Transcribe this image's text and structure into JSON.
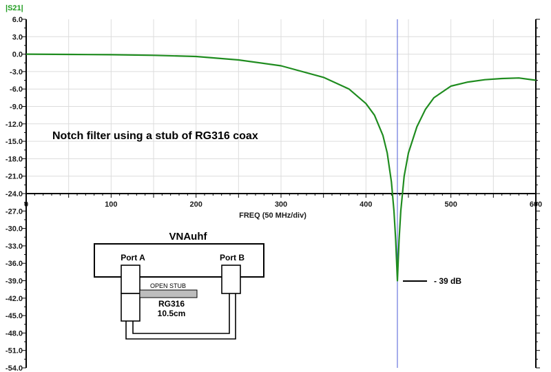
{
  "chart_data": {
    "type": "line",
    "ylabel": "|S21|",
    "xlabel": "FREQ (50 MHz/div)",
    "xlim": [
      0,
      600
    ],
    "ylim": [
      -54,
      6
    ],
    "xticks": [
      0,
      100,
      200,
      300,
      400,
      500,
      600
    ],
    "yticks": [
      6,
      3,
      0,
      -3,
      -6,
      -9,
      -12,
      -15,
      -18,
      -21,
      -24,
      -27,
      -30,
      -33,
      -36,
      -39,
      -42,
      -45,
      -48,
      -51,
      -54
    ],
    "ytick_labels": [
      "6.0",
      "3.0",
      "0.0",
      "-3.0",
      "-6.0",
      "-9.0",
      "-12.0",
      "-15.0",
      "-18.0",
      "-21.0",
      "-24.0",
      "-27.0",
      "-30.0",
      "-33.0",
      "-36.0",
      "-39.0",
      "-42.0",
      "-45.0",
      "-48.0",
      "-51.0",
      "-54.0"
    ],
    "xtick_labels": [
      "0",
      "100",
      "200",
      "300",
      "400",
      "500",
      "600"
    ],
    "grid": true,
    "marker_x": 437,
    "series": [
      {
        "color": "#1f8c1f",
        "x": [
          0,
          50,
          100,
          150,
          200,
          250,
          300,
          350,
          380,
          400,
          410,
          420,
          425,
          430,
          433,
          435,
          437,
          439,
          441,
          445,
          450,
          460,
          470,
          480,
          500,
          520,
          540,
          560,
          580,
          600
        ],
        "y": [
          0,
          -0.05,
          -0.1,
          -0.2,
          -0.4,
          -1.0,
          -2.0,
          -4.0,
          -6.0,
          -8.5,
          -10.5,
          -14.0,
          -17.0,
          -22.0,
          -27.0,
          -32.0,
          -39.0,
          -32.0,
          -27.0,
          -21.0,
          -17.0,
          -12.5,
          -9.5,
          -7.5,
          -5.5,
          -4.8,
          -4.4,
          -4.2,
          -4.1,
          -4.5
        ]
      }
    ],
    "annotations": {
      "title": "Notch filter using a stub of RG316 coax",
      "min_label": "- 39 dB"
    },
    "diagram": {
      "device": "VNAuhf",
      "port_a": "Port A",
      "port_b": "Port B",
      "stub_label": "OPEN STUB",
      "cable": "RG316",
      "length": "10.5cm"
    }
  },
  "colors": {
    "trace": "#1f8c1f",
    "marker": "#4a5ad6",
    "ylabel": "#1f9c1f",
    "grid": "#dcdcdc"
  }
}
